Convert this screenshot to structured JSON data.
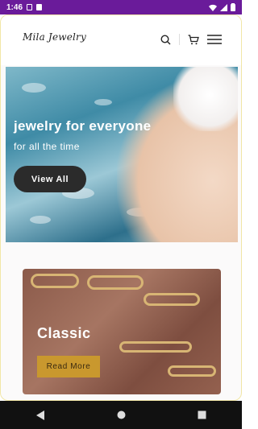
{
  "status_bar": {
    "time": "1:46"
  },
  "header": {
    "logo_text": "Mila Jewelry"
  },
  "hero": {
    "title": "jewelry for everyone",
    "subtitle": "for all the time",
    "button_label": "View All"
  },
  "card": {
    "title": "Classic",
    "button_label": "Read More"
  },
  "colors": {
    "status_bar": "#6a1b9a",
    "accent_gold": "#c9982e",
    "dark_button": "#2b2b2b"
  }
}
